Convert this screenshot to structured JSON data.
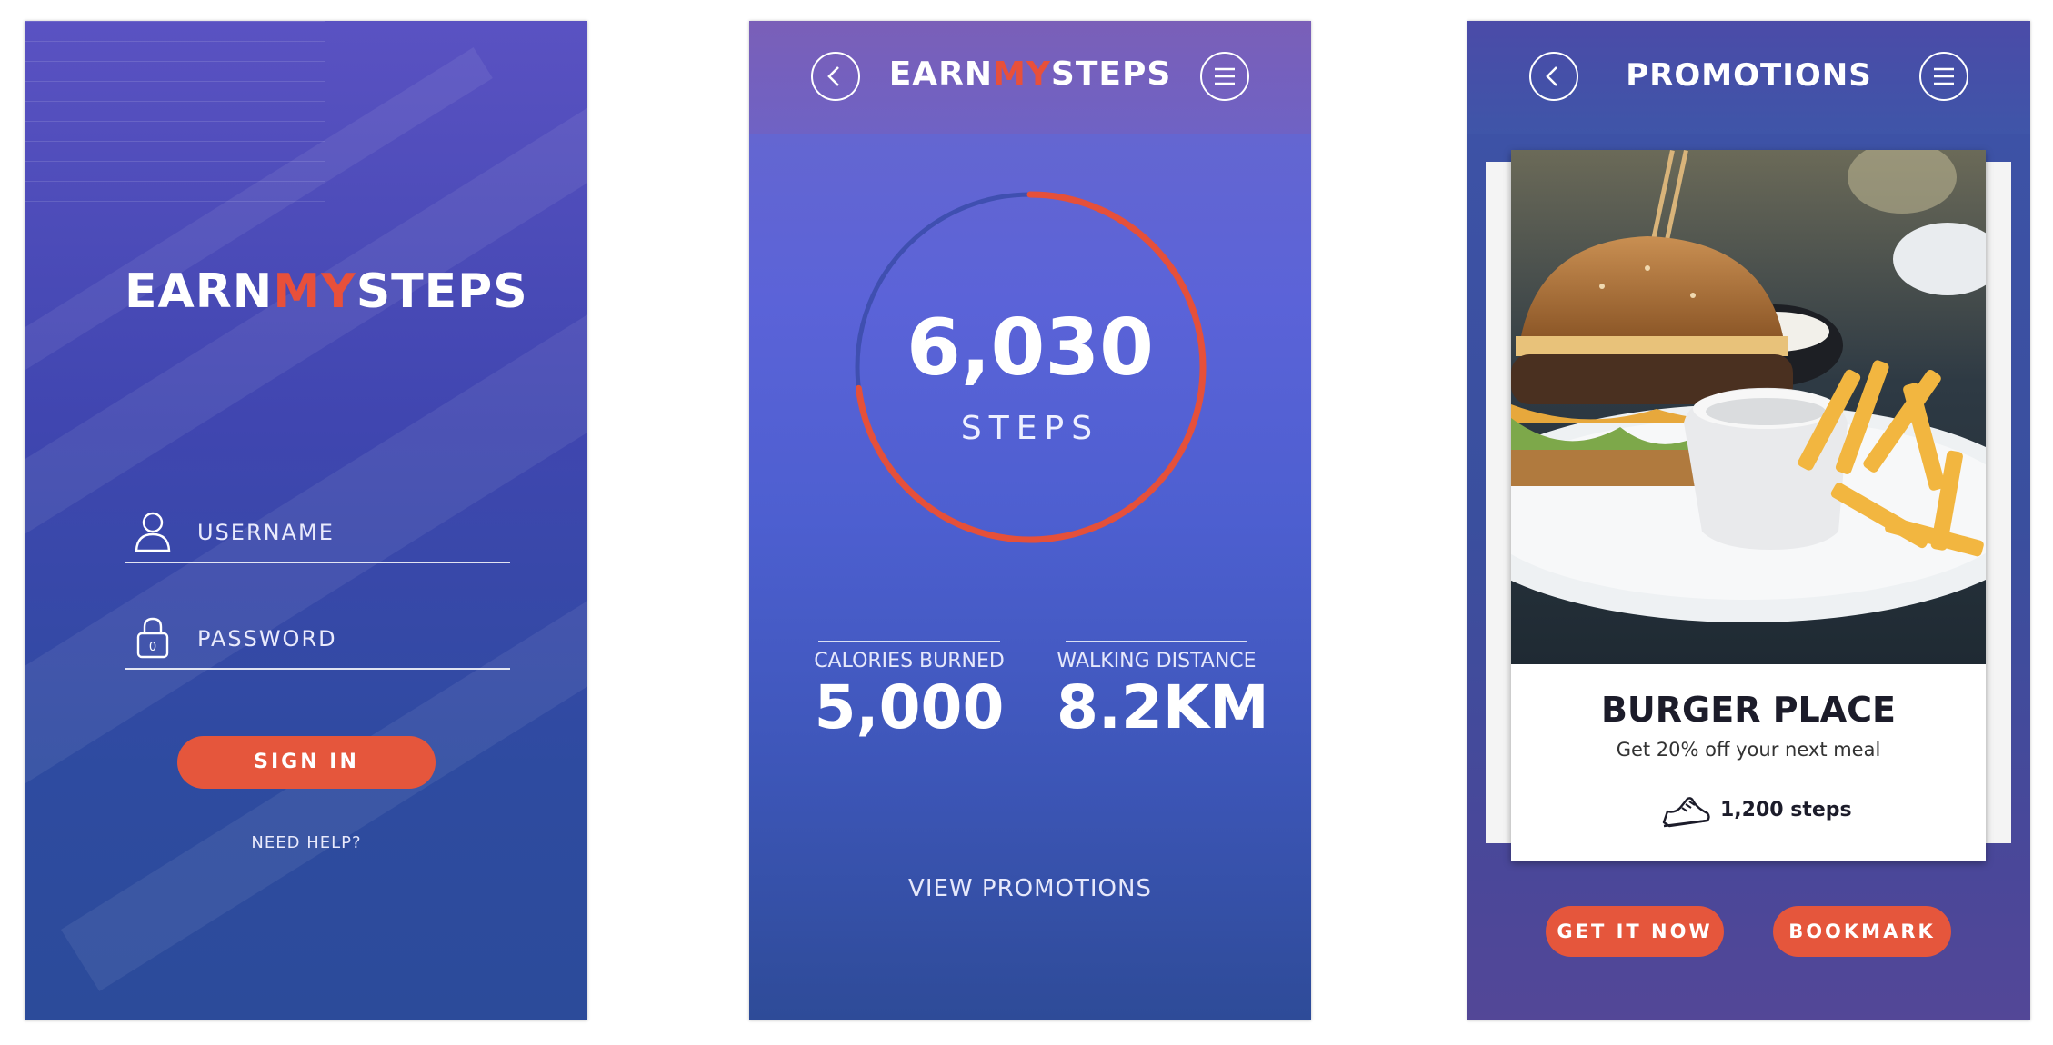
{
  "login": {
    "logo": {
      "part1": "EARN",
      "part2": "MY",
      "part3": "STEPS"
    },
    "username_placeholder": "USERNAME",
    "password_placeholder": "PASSWORD",
    "sign_in_label": "SIGN IN",
    "help_label": "NEED HELP?"
  },
  "tracker": {
    "logo": {
      "part1": "EARN",
      "part2": "MY",
      "part3": "STEPS"
    },
    "steps_value": "6,030",
    "steps_label": "STEPS",
    "progress_fraction": 0.73,
    "calories_label": "CALORIES BURNED",
    "calories_value": "5,000",
    "distance_label": "WALKING DISTANCE",
    "distance_value": "8.2KM",
    "view_promotions_label": "VIEW PROMOTIONS"
  },
  "promotions": {
    "title": "PROMOTIONS",
    "card": {
      "name": "BURGER PLACE",
      "offer": "Get 20% off your next meal",
      "cost": "1,200 steps"
    },
    "get_it_label": "GET IT NOW",
    "bookmark_label": "BOOKMARK"
  },
  "icons": {
    "back": "back-arrow-icon",
    "menu": "hamburger-menu-icon",
    "user": "user-icon",
    "lock": "lock-icon",
    "shoe": "sneaker-icon"
  },
  "colors": {
    "accent": "#e5563c",
    "ring_track": "#3f4fb0",
    "ring_progress": "#e5503a"
  }
}
